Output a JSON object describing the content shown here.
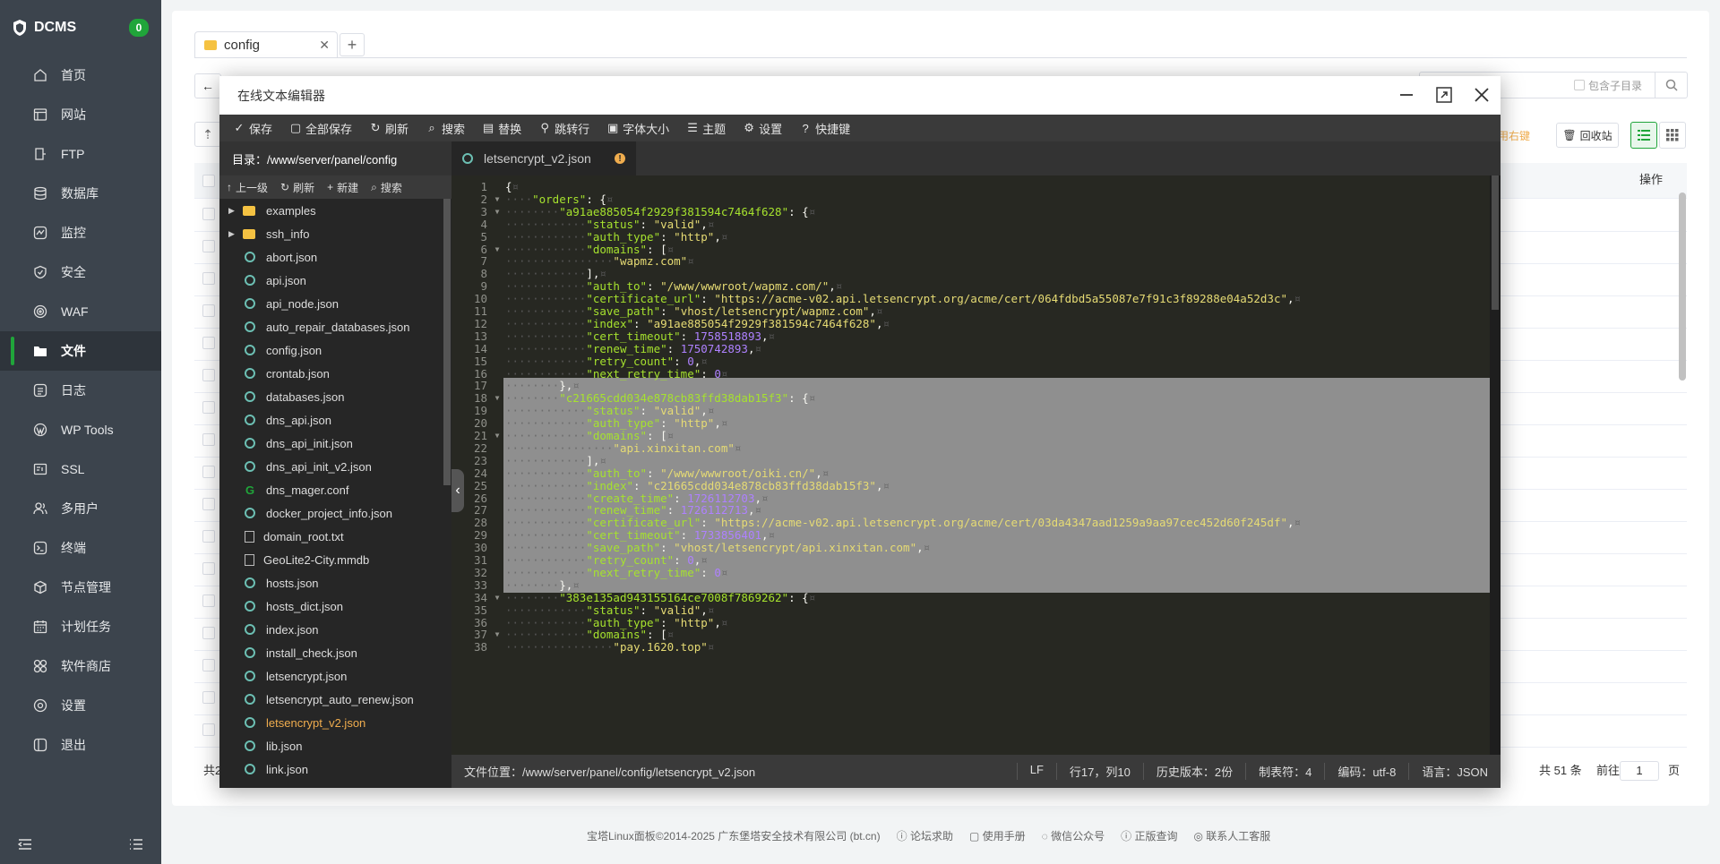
{
  "sidebar": {
    "brand": "DCMS",
    "badge": "0",
    "items": [
      {
        "label": "首页",
        "icon": "home-icon"
      },
      {
        "label": "网站",
        "icon": "website-icon"
      },
      {
        "label": "FTP",
        "icon": "ftp-icon"
      },
      {
        "label": "数据库",
        "icon": "database-icon"
      },
      {
        "label": "监控",
        "icon": "monitor-icon"
      },
      {
        "label": "安全",
        "icon": "shield-icon"
      },
      {
        "label": "WAF",
        "icon": "waf-icon"
      },
      {
        "label": "文件",
        "icon": "folder-icon"
      },
      {
        "label": "日志",
        "icon": "log-icon"
      },
      {
        "label": "WP Tools",
        "icon": "wordpress-icon"
      },
      {
        "label": "SSL",
        "icon": "ssl-icon"
      },
      {
        "label": "多用户",
        "icon": "users-icon"
      },
      {
        "label": "终端",
        "icon": "terminal-icon"
      },
      {
        "label": "节点管理",
        "icon": "node-icon"
      },
      {
        "label": "计划任务",
        "icon": "calendar-icon"
      },
      {
        "label": "软件商店",
        "icon": "store-icon"
      },
      {
        "label": "设置",
        "icon": "gear-icon"
      },
      {
        "label": "退出",
        "icon": "logout-icon"
      }
    ],
    "active_index": 7
  },
  "files_page": {
    "tab_label": "config",
    "include_subdir": "包含子目录",
    "right_hint": "使用右键",
    "recycle": "回收站",
    "op_col": "操作",
    "pager_left": "共2",
    "pager_total": "共 51 条",
    "pager_goto": "前往",
    "pager_page": "1",
    "pager_unit": "页"
  },
  "footer": {
    "copyright": "宝塔Linux面板©2014-2025 广东堡塔安全技术有限公司 (bt.cn)",
    "links": [
      "论坛求助",
      "使用手册",
      "微信公众号",
      "正版查询",
      "联系人工客服"
    ]
  },
  "editor": {
    "title": "在线文本编辑器",
    "toolbar": [
      "保存",
      "全部保存",
      "刷新",
      "搜索",
      "替换",
      "跳转行",
      "字体大小",
      "主题",
      "设置",
      "快捷键"
    ],
    "dir_label": "目录：/www/server/panel/config",
    "tree_tools": [
      "上一级",
      "刷新",
      "新建",
      "搜索"
    ],
    "files": [
      {
        "name": "examples",
        "type": "dir"
      },
      {
        "name": "ssh_info",
        "type": "dir"
      },
      {
        "name": "abort.json",
        "type": "json"
      },
      {
        "name": "api.json",
        "type": "json"
      },
      {
        "name": "api_node.json",
        "type": "json"
      },
      {
        "name": "auto_repair_databases.json",
        "type": "json"
      },
      {
        "name": "config.json",
        "type": "json"
      },
      {
        "name": "crontab.json",
        "type": "json"
      },
      {
        "name": "databases.json",
        "type": "json"
      },
      {
        "name": "dns_api.json",
        "type": "json"
      },
      {
        "name": "dns_api_init.json",
        "type": "json"
      },
      {
        "name": "dns_api_init_v2.json",
        "type": "json"
      },
      {
        "name": "dns_mager.conf",
        "type": "conf"
      },
      {
        "name": "docker_project_info.json",
        "type": "json"
      },
      {
        "name": "domain_root.txt",
        "type": "txt"
      },
      {
        "name": "GeoLite2-City.mmdb",
        "type": "txt"
      },
      {
        "name": "hosts.json",
        "type": "json"
      },
      {
        "name": "hosts_dict.json",
        "type": "json"
      },
      {
        "name": "index.json",
        "type": "json"
      },
      {
        "name": "install_check.json",
        "type": "json"
      },
      {
        "name": "letsencrypt.json",
        "type": "json"
      },
      {
        "name": "letsencrypt_auto_renew.json",
        "type": "json"
      },
      {
        "name": "letsencrypt_v2.json",
        "type": "json",
        "active": true
      },
      {
        "name": "lib.json",
        "type": "json"
      },
      {
        "name": "link.json",
        "type": "json"
      }
    ],
    "open_tab": "letsencrypt_v2.json",
    "code_lines": [
      "{",
      "    \"orders\": {",
      "        \"a91ae885054f2929f381594c7464f628\": {",
      "            \"status\": \"valid\",",
      "            \"auth_type\": \"http\",",
      "            \"domains\": [",
      "                \"wapmz.com\"",
      "            ],",
      "            \"auth_to\": \"/www/wwwroot/wapmz.com/\",",
      "            \"certificate_url\": \"https://acme-v02.api.letsencrypt.org/acme/cert/064fdbd5a55087e7f91c3f89288e04a52d3c\",",
      "            \"save_path\": \"vhost/letsencrypt/wapmz.com\",",
      "            \"index\": \"a91ae885054f2929f381594c7464f628\",",
      "            \"cert_timeout\": 1758518893,",
      "            \"renew_time\": 1750742893,",
      "            \"retry_count\": 0,",
      "            \"next_retry_time\": 0",
      "        },",
      "        \"c21665cdd034e878cb83ffd38dab15f3\": {",
      "            \"status\": \"valid\",",
      "            \"auth_type\": \"http\",",
      "            \"domains\": [",
      "                \"api.xinxitan.com\"",
      "            ],",
      "            \"auth_to\": \"/www/wwwroot/oiki.cn/\",",
      "            \"index\": \"c21665cdd034e878cb83ffd38dab15f3\",",
      "            \"create_time\": 1726112703,",
      "            \"renew_time\": 1726112713,",
      "            \"certificate_url\": \"https://acme-v02.api.letsencrypt.org/acme/cert/03da4347aad1259a9aa97cec452d60f245df\",",
      "            \"cert_timeout\": 1733856401,",
      "            \"save_path\": \"vhost/letsencrypt/api.xinxitan.com\",",
      "            \"retry_count\": 0,",
      "            \"next_retry_time\": 0",
      "        },",
      "        \"383e135ad943155164ce7008f7869262\": {",
      "            \"status\": \"valid\",",
      "            \"auth_type\": \"http\",",
      "            \"domains\": [",
      "                \"pay.1620.top\""
    ],
    "selected_from": 17,
    "selected_to": 33,
    "fold_lines": [
      2,
      3,
      6,
      18,
      21,
      34,
      37
    ],
    "status": {
      "file_path": "文件位置：/www/server/panel/config/letsencrypt_v2.json",
      "eol": "LF",
      "pos": "行17，列10",
      "history": "历史版本：2份",
      "tab": "制表符：4",
      "encoding": "编码：utf-8",
      "lang": "语言：JSON"
    }
  }
}
